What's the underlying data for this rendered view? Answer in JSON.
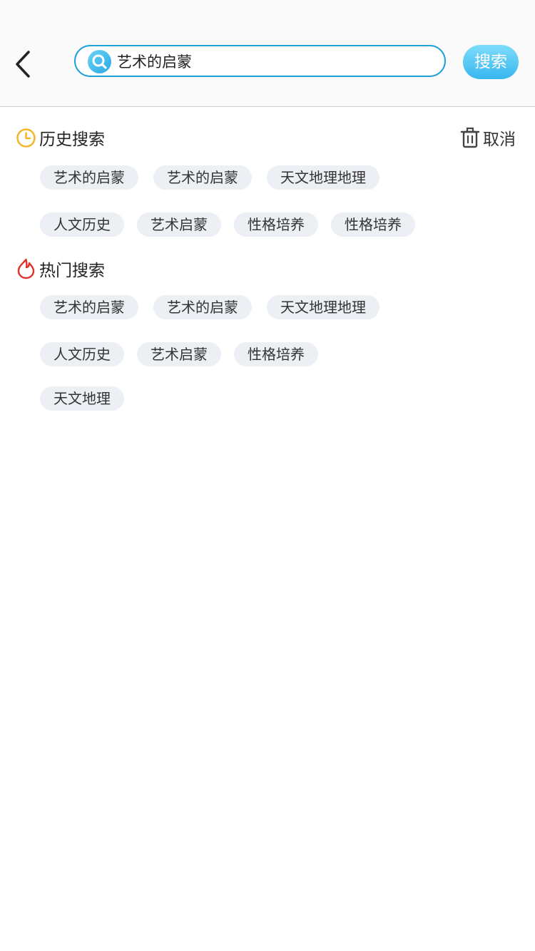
{
  "search": {
    "value": "艺术的启蒙",
    "button_label": "搜索"
  },
  "history": {
    "title": "历史搜索",
    "clear_label": "取消",
    "tags": [
      "艺术的启蒙",
      "艺术的启蒙",
      "天文地理地理",
      "人文历史",
      "艺术启蒙",
      "性格培养",
      "性格培养"
    ]
  },
  "hot": {
    "title": "热门搜索",
    "tags": [
      "艺术的启蒙",
      "艺术的启蒙",
      "天文地理地理",
      "人文历史",
      "艺术启蒙",
      "性格培养",
      "天文地理"
    ]
  },
  "colors": {
    "accent": "#1ea0d9",
    "history_icon": "#f3b52c",
    "hot_icon": "#e0322b",
    "tag_bg": "#eceff3"
  },
  "icons": {
    "back": "chevron-left-icon",
    "search": "search-icon",
    "history": "clock-icon",
    "clear": "trash-icon",
    "hot": "flame-icon"
  }
}
